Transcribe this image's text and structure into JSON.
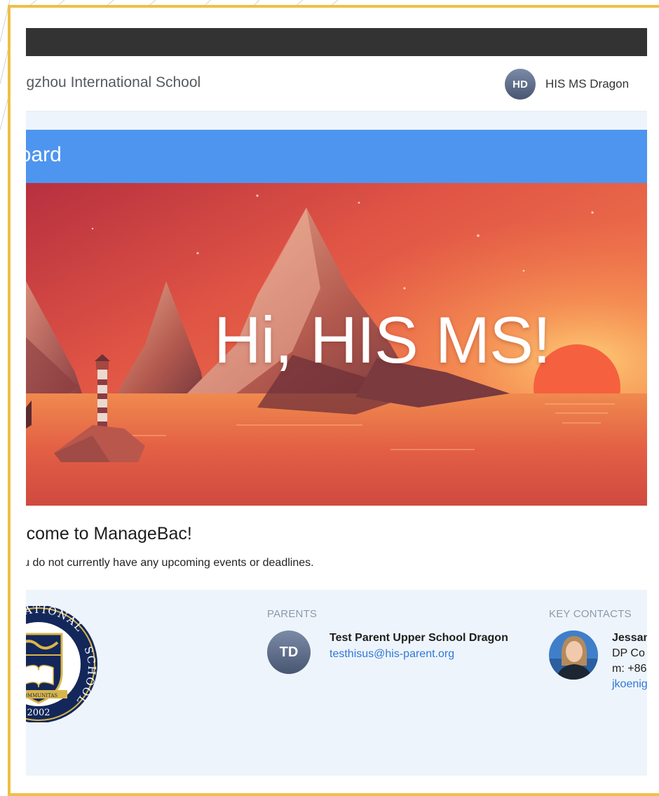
{
  "app": {
    "school_name": "Hangzhou International School",
    "user": {
      "initials": "HD",
      "name": "HIS MS Dragon"
    }
  },
  "page": {
    "title": "Dashboard"
  },
  "hero": {
    "greeting": "Hi, HIS MS!"
  },
  "welcome": {
    "title": "Welcome to ManageBac!",
    "subtitle": "You do not currently have any upcoming events or deadlines."
  },
  "school_seal": {
    "text_top": "INTERNATIONAL",
    "text_right": "SCHOOL",
    "banner": "COMMUNITAS",
    "year": "2002"
  },
  "parents": {
    "label": "PARENTS",
    "items": [
      {
        "initials": "TD",
        "name": "Test Parent Upper School Dragon",
        "email": "testhisus@his-parent.org"
      }
    ]
  },
  "key_contacts": {
    "label": "KEY CONTACTS",
    "items": [
      {
        "name": "Jessan",
        "role": "DP Co",
        "phone": "m: +86",
        "email": "jkoenig"
      }
    ]
  },
  "colors": {
    "topbar": "#333333",
    "header_blue": "#4e95f0",
    "panel_bg": "#eef4fb",
    "link": "#2f78d6",
    "frame_border": "#f0bf45"
  }
}
